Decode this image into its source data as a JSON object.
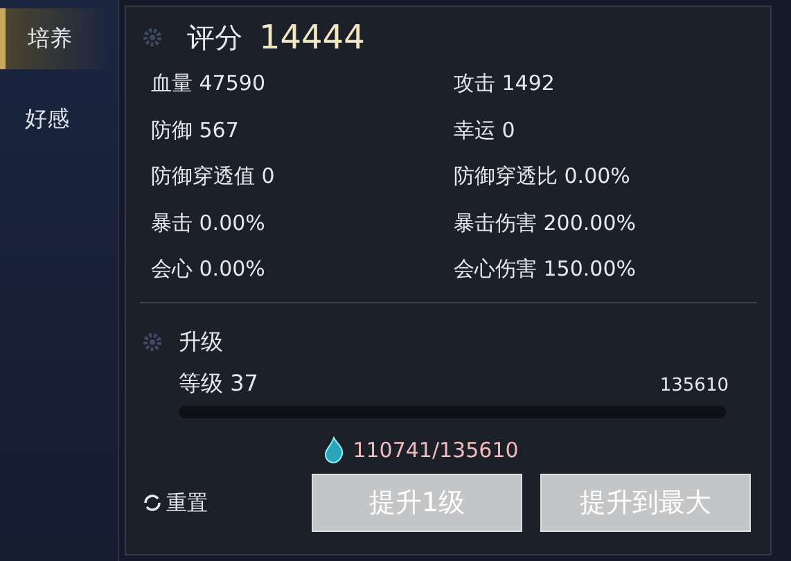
{
  "tabs": [
    {
      "label": "培养",
      "selected": true
    },
    {
      "label": "好感",
      "selected": false
    }
  ],
  "score": {
    "label": "评分",
    "value": "14444"
  },
  "stats": [
    {
      "text": "血量 47590"
    },
    {
      "text": "攻击 1492"
    },
    {
      "text": "防御 567"
    },
    {
      "text": "幸运 0"
    },
    {
      "text": "防御穿透值 0"
    },
    {
      "text": "防御穿透比 0.00%"
    },
    {
      "text": "暴击 0.00%"
    },
    {
      "text": "暴击伤害 200.00%"
    },
    {
      "text": "会心 0.00%"
    },
    {
      "text": "会心伤害 150.00%"
    }
  ],
  "upgrade": {
    "title": "升级",
    "level_label": "等级 37",
    "required": "135610",
    "level": 0,
    "cost": "110741/135610"
  },
  "reset": "重置",
  "buttons": [
    "提升1级",
    "提升到最大"
  ]
}
